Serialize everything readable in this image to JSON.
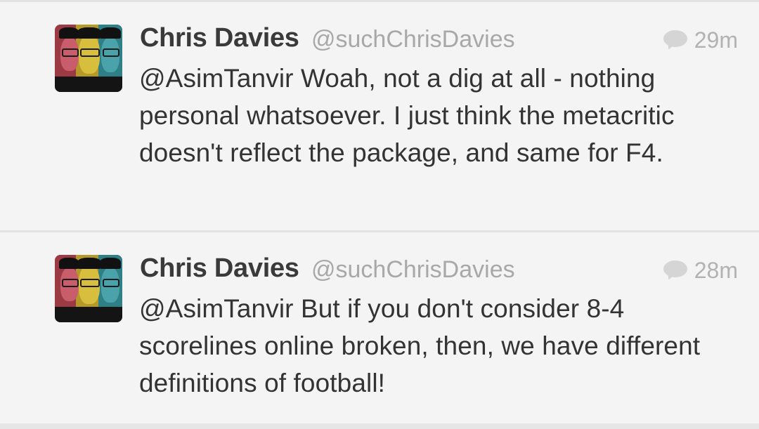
{
  "tweets": [
    {
      "name": "Chris Davies",
      "handle": "@suchChrisDavies",
      "time": "29m",
      "text": "@AsimTanvir Woah, not a dig at all - nothing personal whatsoever. I just think the metacritic doesn't reflect the package, and same for F4."
    },
    {
      "name": "Chris Davies",
      "handle": "@suchChrisDavies",
      "time": "28m",
      "text": "@AsimTanvir But if you don't consider 8-4 scorelines online broken, then, we have different definitions of football!"
    }
  ],
  "icons": {
    "reply": "speech-bubble-icon",
    "avatar": "profile-avatar"
  },
  "colors": {
    "background": "#f4f4f4",
    "name": "#3a3a3a",
    "handle": "#a8a8a8",
    "text": "#333333",
    "divider": "#e2e2e2"
  }
}
